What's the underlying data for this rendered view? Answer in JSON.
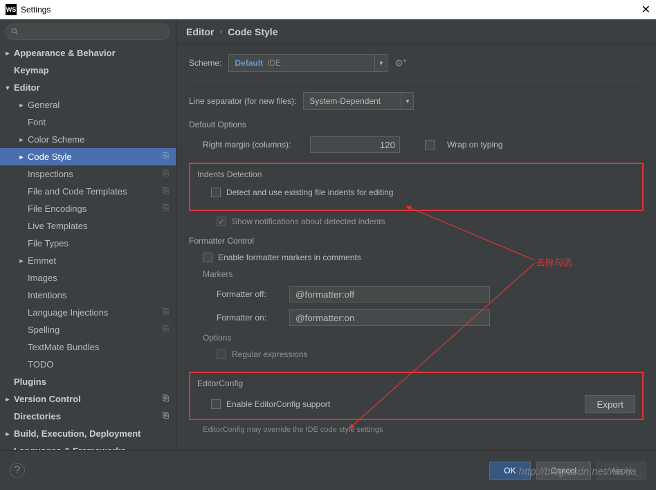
{
  "window": {
    "title": "Settings"
  },
  "sidebar": {
    "search_placeholder": "",
    "items": [
      {
        "label": "Appearance & Behavior",
        "level": 1,
        "arrow": "►"
      },
      {
        "label": "Keymap",
        "level": 1
      },
      {
        "label": "Editor",
        "level": 1,
        "arrow": "▼"
      },
      {
        "label": "General",
        "level": 2,
        "arrow": "►"
      },
      {
        "label": "Font",
        "level": 2
      },
      {
        "label": "Color Scheme",
        "level": 2,
        "arrow": "►"
      },
      {
        "label": "Code Style",
        "level": 2,
        "arrow": "►",
        "selected": true,
        "badge": "⎘"
      },
      {
        "label": "Inspections",
        "level": 2,
        "badge": "⎘"
      },
      {
        "label": "File and Code Templates",
        "level": 2,
        "badge": "⎘"
      },
      {
        "label": "File Encodings",
        "level": 2,
        "badge": "⎘"
      },
      {
        "label": "Live Templates",
        "level": 2
      },
      {
        "label": "File Types",
        "level": 2
      },
      {
        "label": "Emmet",
        "level": 2,
        "arrow": "►"
      },
      {
        "label": "Images",
        "level": 2
      },
      {
        "label": "Intentions",
        "level": 2
      },
      {
        "label": "Language Injections",
        "level": 2,
        "badge": "⎘"
      },
      {
        "label": "Spelling",
        "level": 2,
        "badge": "⎘"
      },
      {
        "label": "TextMate Bundles",
        "level": 2
      },
      {
        "label": "TODO",
        "level": 2
      },
      {
        "label": "Plugins",
        "level": 1
      },
      {
        "label": "Version Control",
        "level": 1,
        "arrow": "►",
        "badge": "⎘"
      },
      {
        "label": "Directories",
        "level": 1,
        "badge": "⎘"
      },
      {
        "label": "Build, Execution, Deployment",
        "level": 1,
        "arrow": "►"
      },
      {
        "label": "Languages & Frameworks",
        "level": 1,
        "arrow": "►"
      }
    ]
  },
  "breadcrumb": {
    "part1": "Editor",
    "part2": "Code Style"
  },
  "scheme": {
    "label": "Scheme:",
    "value": "Default",
    "scope": "IDE"
  },
  "lineSep": {
    "label": "Line separator (for new files):",
    "value": "System-Dependent"
  },
  "defaults": {
    "title": "Default Options",
    "margin_label": "Right margin (columns):",
    "margin_value": "120",
    "wrap_label": "Wrap on typing"
  },
  "indents": {
    "title": "Indents Detection",
    "detect_label": "Detect and use existing file indents for editing",
    "notif_label": "Show notifications about detected indents"
  },
  "formatter": {
    "title": "Formatter Control",
    "enable_label": "Enable formatter markers in comments",
    "markers_title": "Markers",
    "off_label": "Formatter off:",
    "off_value": "@formatter:off",
    "on_label": "Formatter on:",
    "on_value": "@formatter:on",
    "options_title": "Options",
    "regex_label": "Regular expressions"
  },
  "editorconfig": {
    "title": "EditorConfig",
    "enable_label": "Enable EditorConfig support",
    "export_label": "Export",
    "hint": "EditorConfig may override the IDE code style settings"
  },
  "footer": {
    "ok": "OK",
    "cancel": "Cancel",
    "apply": "Apply"
  },
  "annotation": {
    "text": "去除勾选"
  },
  "watermark": "http://blog.csdn.net/niexia_"
}
